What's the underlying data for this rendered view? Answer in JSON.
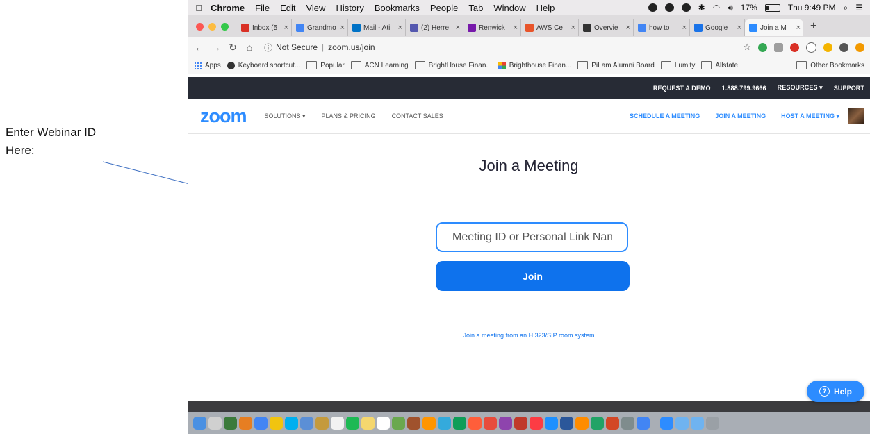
{
  "annotation": {
    "line1": "Enter Webinar ID",
    "line2": "Here:"
  },
  "macos": {
    "app": "Chrome",
    "menus": [
      "File",
      "Edit",
      "View",
      "History",
      "Bookmarks",
      "People",
      "Tab",
      "Window",
      "Help"
    ],
    "battery": "17%",
    "clock": "Thu 9:49 PM"
  },
  "tabs": [
    {
      "label": "Inbox (5",
      "color": "#d93025"
    },
    {
      "label": "Grandmo",
      "color": "#4285f4"
    },
    {
      "label": "Mail - Ati",
      "color": "#0072c6"
    },
    {
      "label": "(2) Herre",
      "color": "#5558af"
    },
    {
      "label": "Renwick",
      "color": "#7719aa"
    },
    {
      "label": "AWS Ce",
      "color": "#e8542a"
    },
    {
      "label": "Overvie",
      "color": "#333333"
    },
    {
      "label": "how to",
      "color": "#4285f4"
    },
    {
      "label": "Google",
      "color": "#1a73e8"
    },
    {
      "label": "Join a M",
      "color": "#2d8cff"
    }
  ],
  "address": {
    "security": "Not Secure",
    "url": "zoom.us/join"
  },
  "bookmarks": [
    {
      "label": "Apps",
      "icon": "apps-grid-icon"
    },
    {
      "label": "Keyboard shortcut...",
      "icon": "keyboard-site-icon"
    },
    {
      "label": "Popular",
      "icon": "folder-icon"
    },
    {
      "label": "ACN Learning",
      "icon": "folder-icon"
    },
    {
      "label": "BrightHouse Finan...",
      "icon": "folder-icon"
    },
    {
      "label": "Brighthouse Finan...",
      "icon": "colorful-site-icon"
    },
    {
      "label": "PiLam Alumni Board",
      "icon": "folder-icon"
    },
    {
      "label": "Lumity",
      "icon": "folder-icon"
    },
    {
      "label": "Allstate",
      "icon": "folder-icon"
    }
  ],
  "other_bookmarks": "Other Bookmarks",
  "zoom": {
    "top_links": [
      "REQUEST A DEMO",
      "1.888.799.9666",
      "RESOURCES ▾",
      "SUPPORT"
    ],
    "logo": "zoom",
    "nav_left": [
      "SOLUTIONS ▾",
      "PLANS & PRICING",
      "CONTACT SALES"
    ],
    "nav_right": [
      "SCHEDULE A MEETING",
      "JOIN A MEETING",
      "HOST A MEETING ▾"
    ],
    "brand_color": "#2d8cff",
    "title": "Join a Meeting",
    "input_placeholder": "Meeting ID or Personal Link Name",
    "join_label": "Join",
    "h323_link": "Join a meeting from an H.323/SIP room system",
    "help_label": "Help"
  },
  "dock_colors": [
    "#4a90e2",
    "#d0d0d0",
    "#3b7a3b",
    "#e67e22",
    "#4285f4",
    "#f1c40f",
    "#00aff0",
    "#5b8fd6",
    "#c49a3d",
    "#f2f2f2",
    "#1db954",
    "#f5d76e",
    "#ffffff",
    "#6aa84f",
    "#a0522d",
    "#ff9500",
    "#34aadc",
    "#0f9d58",
    "#ff5e3a",
    "#e74c3c",
    "#8e44ad",
    "#c0392b",
    "#fc3c44",
    "#1e90ff",
    "#2b579a",
    "#ff8c00",
    "#21a366",
    "#d24726",
    "#7f8c8d",
    "#4285f4",
    "#2d8cff",
    "#6fb3f0",
    "#6fb3f0",
    "#9aa0a6"
  ]
}
